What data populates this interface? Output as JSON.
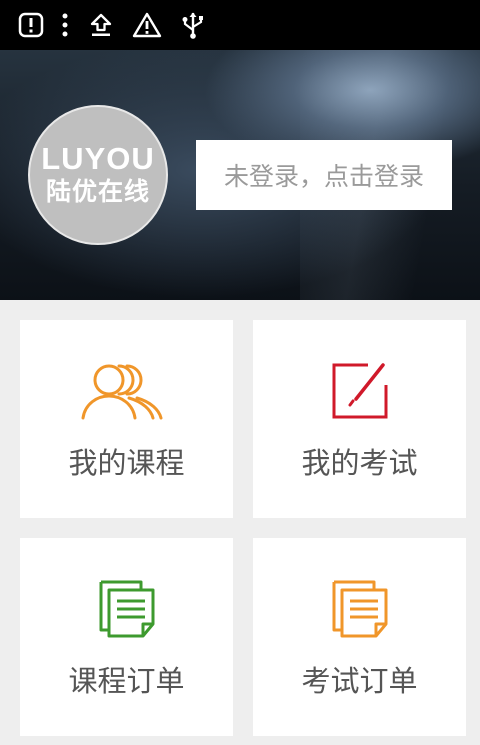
{
  "status_bar": {
    "icons": [
      "alert-box-icon",
      "more-vertical-icon",
      "upload-icon",
      "warning-icon",
      "usb-icon"
    ]
  },
  "header": {
    "logo_en": "LUYOU",
    "logo_cn": "陆优在线",
    "login_label": "未登录，点击登录"
  },
  "menu": {
    "items": [
      {
        "label": "我的课程",
        "icon": "people-icon",
        "color": "#f0962a"
      },
      {
        "label": "我的考试",
        "icon": "edit-square-icon",
        "color": "#d0192a"
      },
      {
        "label": "课程订单",
        "icon": "document-green-icon",
        "color": "#3d9a2e"
      },
      {
        "label": "考试订单",
        "icon": "document-orange-icon",
        "color": "#f0962a"
      }
    ]
  }
}
